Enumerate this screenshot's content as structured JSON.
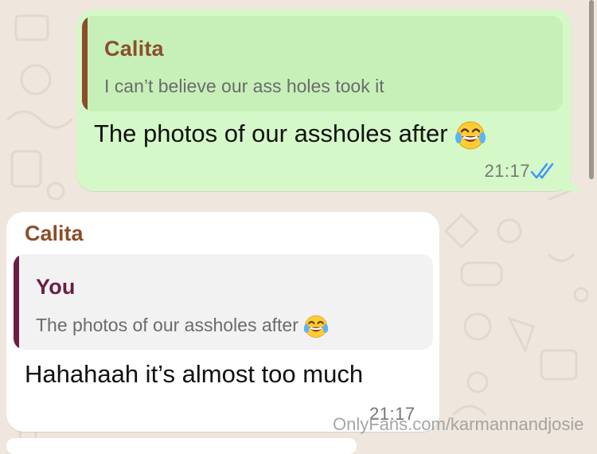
{
  "messages": {
    "outgoing": {
      "reply_to": {
        "author": "Calita",
        "text": "I can’t believe our ass holes took it"
      },
      "text": "The photos of our assholes after",
      "emoji": "face-with-tears-of-joy",
      "time": "21:17",
      "status": "read"
    },
    "incoming": {
      "sender": "Calita",
      "reply_to": {
        "author": "You",
        "text": "The photos of our assholes after",
        "emoji": "face-with-tears-of-joy"
      },
      "text": "Hahahaah it’s almost too much",
      "time": "21:17"
    }
  },
  "watermark": "OnlyFans.com/karmannandjosie",
  "colors": {
    "chat_background": "#efe7dd",
    "outgoing_bubble": "#d5f8c8",
    "incoming_bubble": "#ffffff",
    "calita_name": "#8b4e2b",
    "you_name": "#6b1d43",
    "read_ticks": "#3497f9"
  }
}
